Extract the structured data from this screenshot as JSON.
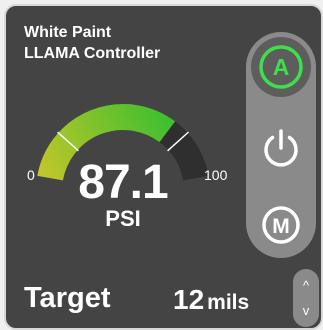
{
  "controller": {
    "title_line1": "White Paint",
    "title_line2": "LLAMA Controller"
  },
  "gauge": {
    "value": 87.1,
    "value_text": "87.1",
    "unit": "PSI",
    "min": 0,
    "max": 100,
    "min_label": "0",
    "max_label": "100",
    "fill_end_fraction": 0.73,
    "low_marker_fraction": 0.2,
    "high_marker_fraction": 0.8,
    "colors": {
      "track": "#2f2f2f",
      "fill_start": "#c8c62a",
      "fill_end": "#3fbf2f",
      "marker": "#ffffff"
    }
  },
  "mode_panel": {
    "auto": {
      "glyph": "A",
      "icon": "auto-mode-icon",
      "active": true,
      "color": "#3ee04a"
    },
    "power": {
      "icon": "power-icon"
    },
    "manual": {
      "glyph": "M",
      "icon": "manual-mode-icon"
    }
  },
  "target": {
    "label": "Target",
    "value": "12",
    "unit": "mils",
    "up_icon": "chevron-up-icon",
    "down_icon": "chevron-down-icon",
    "up_glyph": "^",
    "down_glyph": "v"
  }
}
